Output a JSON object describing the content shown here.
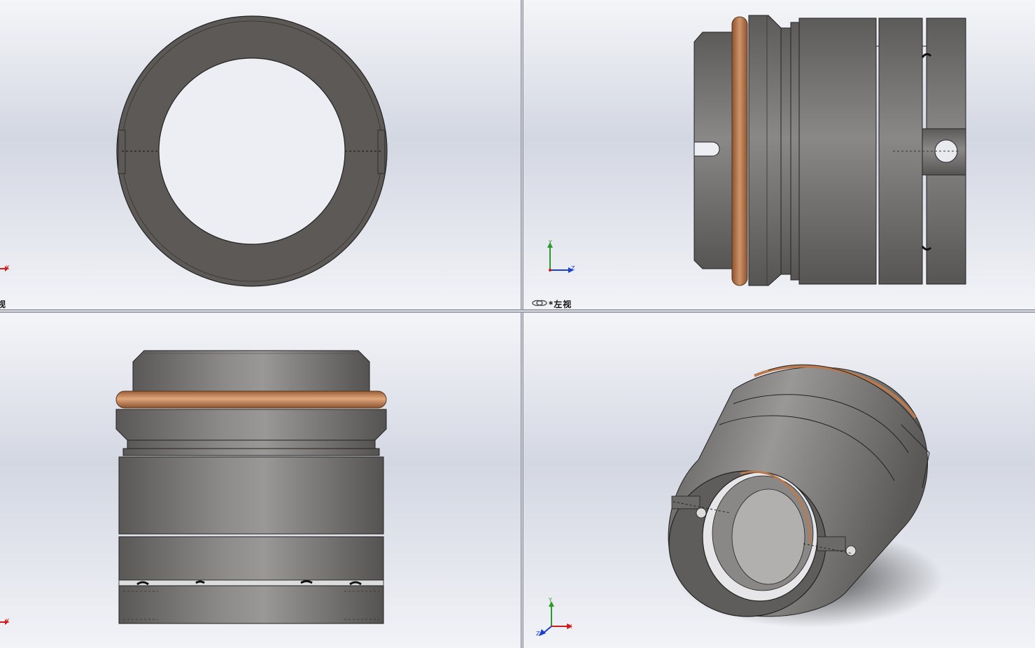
{
  "viewports": {
    "top_left": {
      "label": "视"
    },
    "top_right": {
      "label": "*左视"
    },
    "bottom_left": {
      "label": ""
    },
    "bottom_right": {
      "label": ""
    }
  },
  "axes": {
    "x": "X",
    "y": "Y",
    "z": "Z"
  },
  "colors": {
    "part_gray": "#6b6a68",
    "part_dark": "#5a5755",
    "oring_copper": "#b87a4e",
    "axis_x": "#d11a1a",
    "axis_y": "#2a9a2a",
    "axis_z": "#1a3fd1"
  }
}
